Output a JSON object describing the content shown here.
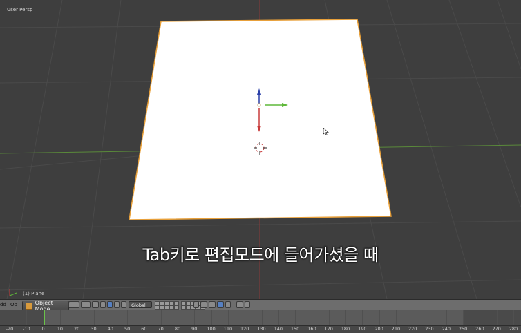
{
  "viewport": {
    "view_label": "User Persp",
    "object_label": "(1) Plane",
    "subtitle": "Tab키로 편집모드에 들어가셨을 때"
  },
  "header": {
    "left_fragment_1": "dd",
    "left_fragment_2": "Ob",
    "mode_label": "Object Mode",
    "orientation_label": "Global"
  },
  "timeline": {
    "current_frame": 1,
    "ticks": [
      "-20",
      "-10",
      "0",
      "10",
      "20",
      "30",
      "40",
      "50",
      "60",
      "70",
      "80",
      "90",
      "100",
      "110",
      "120",
      "130",
      "140",
      "150",
      "160",
      "170",
      "180",
      "190",
      "200",
      "210",
      "220",
      "230",
      "240",
      "250",
      "260",
      "270",
      "280"
    ]
  },
  "colors": {
    "x_axis": "#c83a3a",
    "y_axis": "#5fb83a",
    "z_axis": "#2a3fa8",
    "plane": "#ffffff",
    "selection_outline": "#e8a03a",
    "playhead": "#6ac24a"
  }
}
